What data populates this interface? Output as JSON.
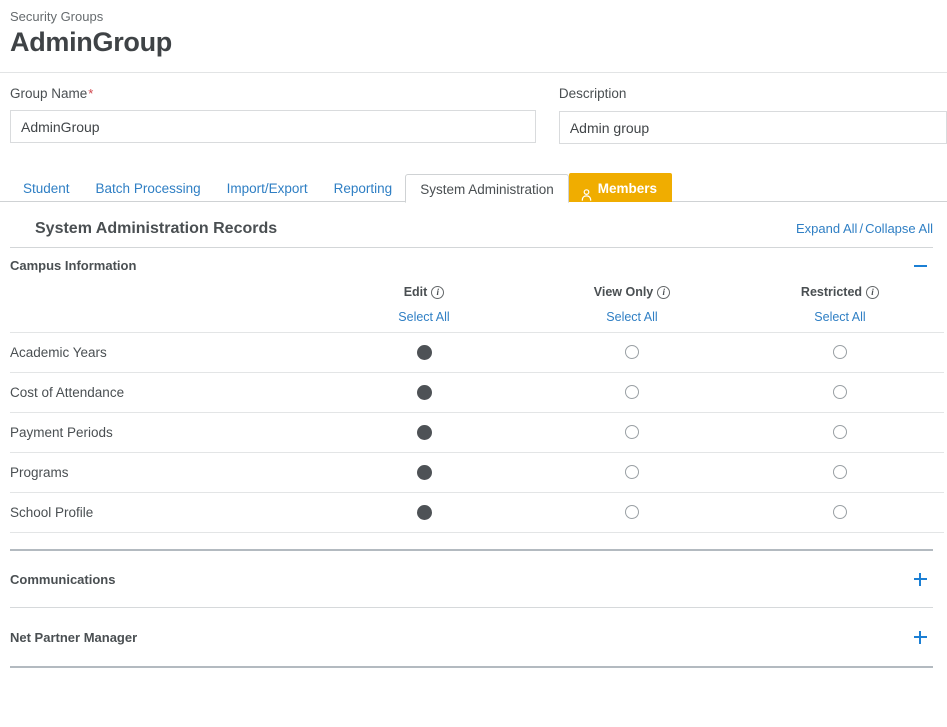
{
  "header": {
    "breadcrumb": "Security Groups",
    "title": "AdminGroup"
  },
  "form": {
    "group_name": {
      "label": "Group Name",
      "required_marker": "*",
      "value": "AdminGroup",
      "placeholder": ""
    },
    "description": {
      "label": "Description",
      "value": "Admin group",
      "placeholder": ""
    }
  },
  "tabs": [
    {
      "label": "Student",
      "state": "link",
      "icon": ""
    },
    {
      "label": "Batch Processing",
      "state": "link",
      "icon": ""
    },
    {
      "label": "Import/Export",
      "state": "link",
      "icon": ""
    },
    {
      "label": "Reporting",
      "state": "link",
      "icon": ""
    },
    {
      "label": "System Administration",
      "state": "active",
      "icon": ""
    },
    {
      "label": "Members",
      "state": "highlight",
      "icon": "person-icon"
    }
  ],
  "panel": {
    "title": "System Administration Records",
    "expand_all": "Expand All",
    "links_separator": "/",
    "collapse_all": "Collapse All"
  },
  "sections": [
    {
      "name": "Campus Information",
      "expanded": true,
      "toggle_icon": "minus-icon",
      "columns": [
        {
          "label": "Edit",
          "info_icon": "info-icon",
          "select_all": "Select All"
        },
        {
          "label": "View Only",
          "info_icon": "info-icon",
          "select_all": "Select All"
        },
        {
          "label": "Restricted",
          "info_icon": "info-icon",
          "select_all": "Select All"
        }
      ],
      "rows": [
        {
          "label": "Academic Years",
          "selected": 0
        },
        {
          "label": "Cost of Attendance",
          "selected": 0
        },
        {
          "label": "Payment Periods",
          "selected": 0
        },
        {
          "label": "Programs",
          "selected": 0
        },
        {
          "label": "School Profile",
          "selected": 0
        }
      ]
    },
    {
      "name": "Communications",
      "expanded": false,
      "toggle_icon": "plus-icon",
      "columns": [],
      "rows": []
    },
    {
      "name": "Net Partner Manager",
      "expanded": false,
      "toggle_icon": "plus-icon",
      "columns": [],
      "rows": []
    }
  ],
  "colors": {
    "link": "#2f7fc4",
    "accent_amber": "#f0ad00",
    "required": "#d0454c",
    "radio_selected": "#4e5256",
    "toggle_blue": "#1b7fd4"
  }
}
